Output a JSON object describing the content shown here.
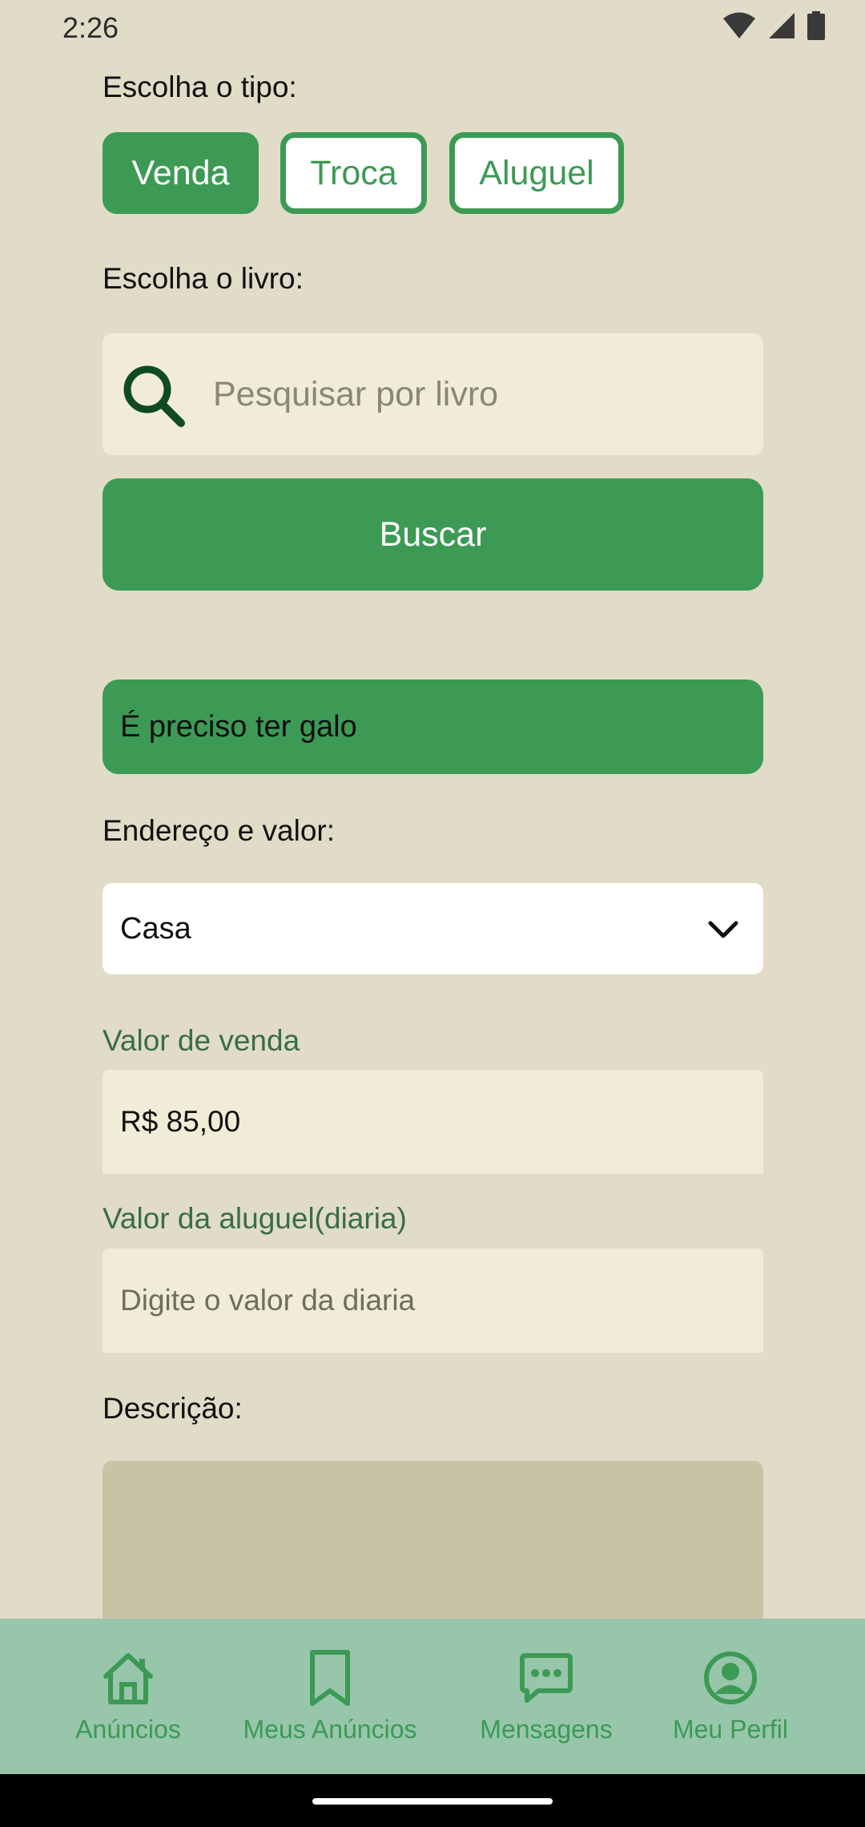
{
  "status_bar": {
    "time": "2:26",
    "icons": [
      "wifi-icon",
      "signal-icon",
      "battery-icon"
    ]
  },
  "form": {
    "type_label": "Escolha o tipo:",
    "types": [
      {
        "label": "Venda",
        "selected": true
      },
      {
        "label": "Troca",
        "selected": false
      },
      {
        "label": "Aluguel",
        "selected": false
      }
    ],
    "book_label": "Escolha o livro:",
    "search": {
      "placeholder": "Pesquisar por livro",
      "value": ""
    },
    "search_button": "Buscar",
    "selected_book": "É preciso ter galo",
    "address_label": "Endereço e valor:",
    "address_select": "Casa",
    "sale_value_label": "Valor de venda",
    "sale_value": "R$ 85,00",
    "rent_value_label": "Valor da aluguel(diaria)",
    "rent_value_placeholder": "Digite o valor da diaria",
    "description_label": "Descrição:",
    "description_value": ""
  },
  "bottom_nav": {
    "items": [
      {
        "label": "Anúncios",
        "icon": "home-icon"
      },
      {
        "label": "Meus Anúncios",
        "icon": "bookmark-icon"
      },
      {
        "label": "Mensagens",
        "icon": "chat-icon"
      },
      {
        "label": "Meu Perfil",
        "icon": "account-circle-icon"
      }
    ]
  },
  "colors": {
    "background": "#e0dcc7",
    "accent": "#3c9a55",
    "field_bg": "#f1ecd7",
    "nav_bg": "#97c6ab",
    "textarea_bg": "#c9c3a6"
  }
}
